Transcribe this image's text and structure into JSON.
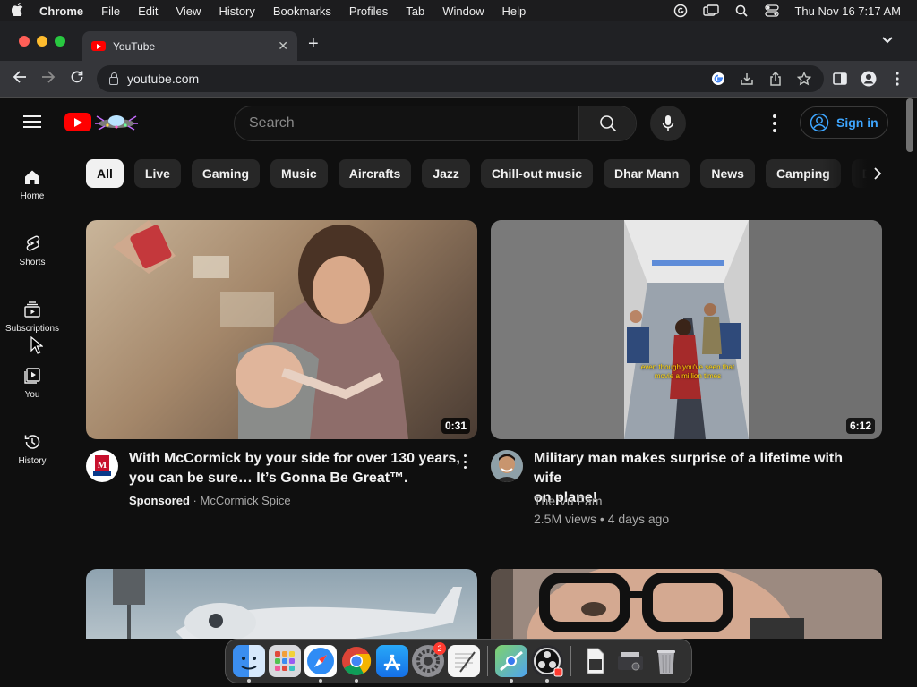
{
  "menubar": {
    "app_name": "Chrome",
    "items": [
      "File",
      "Edit",
      "View",
      "History",
      "Bookmarks",
      "Profiles",
      "Tab",
      "Window",
      "Help"
    ],
    "clock": "Thu Nov 16  7:17 AM",
    "status_icons": [
      "grammarly-icon",
      "display-icon",
      "search-icon",
      "control-center-icon"
    ]
  },
  "browser": {
    "tab_title": "YouTube",
    "url": "youtube.com"
  },
  "youtube": {
    "search_placeholder": "Search",
    "sign_in_label": "Sign in",
    "sidebar": [
      {
        "label": "Home",
        "icon": "home-icon"
      },
      {
        "label": "Shorts",
        "icon": "shorts-icon"
      },
      {
        "label": "Subscriptions",
        "icon": "subscriptions-icon"
      },
      {
        "label": "You",
        "icon": "you-icon"
      },
      {
        "label": "History",
        "icon": "history-icon"
      }
    ],
    "chips": [
      "All",
      "Live",
      "Gaming",
      "Music",
      "Aircrafts",
      "Jazz",
      "Chill-out music",
      "Dhar Mann",
      "News",
      "Camping",
      "D"
    ],
    "active_chip": "All",
    "videos": [
      {
        "title_line1": "With McCormick by your side for over 130 years,",
        "title_line2": "you can be sure… It’s Gonna Be Great™.",
        "sponsored": "Sponsored",
        "channel": "McCormick Spice",
        "duration": "0:31",
        "thumbnail_caption": ""
      },
      {
        "title_line1": "Military man makes surprise of a lifetime with wife",
        "title_line2": "on plane!",
        "channel": "The Vu Fam",
        "stats": "2.5M views • 4 days ago",
        "duration": "6:12",
        "thumbnail_caption": "even though you've seen that movie a million times"
      }
    ]
  },
  "dock": {
    "apps": [
      "finder-icon",
      "launchpad-icon",
      "safari-icon",
      "chrome-icon",
      "app-store-icon",
      "system-settings-icon",
      "textedit-icon",
      "maps-icon",
      "obs-icon",
      "preview-icon",
      "files-icon",
      "trash-icon"
    ],
    "settings_badge": "2"
  },
  "colors": {
    "youtube_red": "#ff0000",
    "link_blue": "#3ea6ff",
    "background": "#0f0f0f"
  }
}
